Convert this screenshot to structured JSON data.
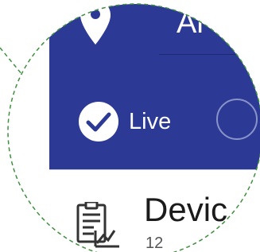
{
  "header": {
    "title_partial": "Al",
    "location_icon": "map-pin-icon"
  },
  "live_toggle": {
    "label": "Live",
    "icon": "check-circle-icon",
    "checked": true
  },
  "next_option": {
    "icon": "radio-ring-icon",
    "checked": false
  },
  "list_item": {
    "title_partial": "Devic",
    "subtitle_partial": "12",
    "icon": "report-chart-icon"
  },
  "colors": {
    "header_bg": "#2c3a96",
    "zoom_ring": "#3f8f3f"
  }
}
